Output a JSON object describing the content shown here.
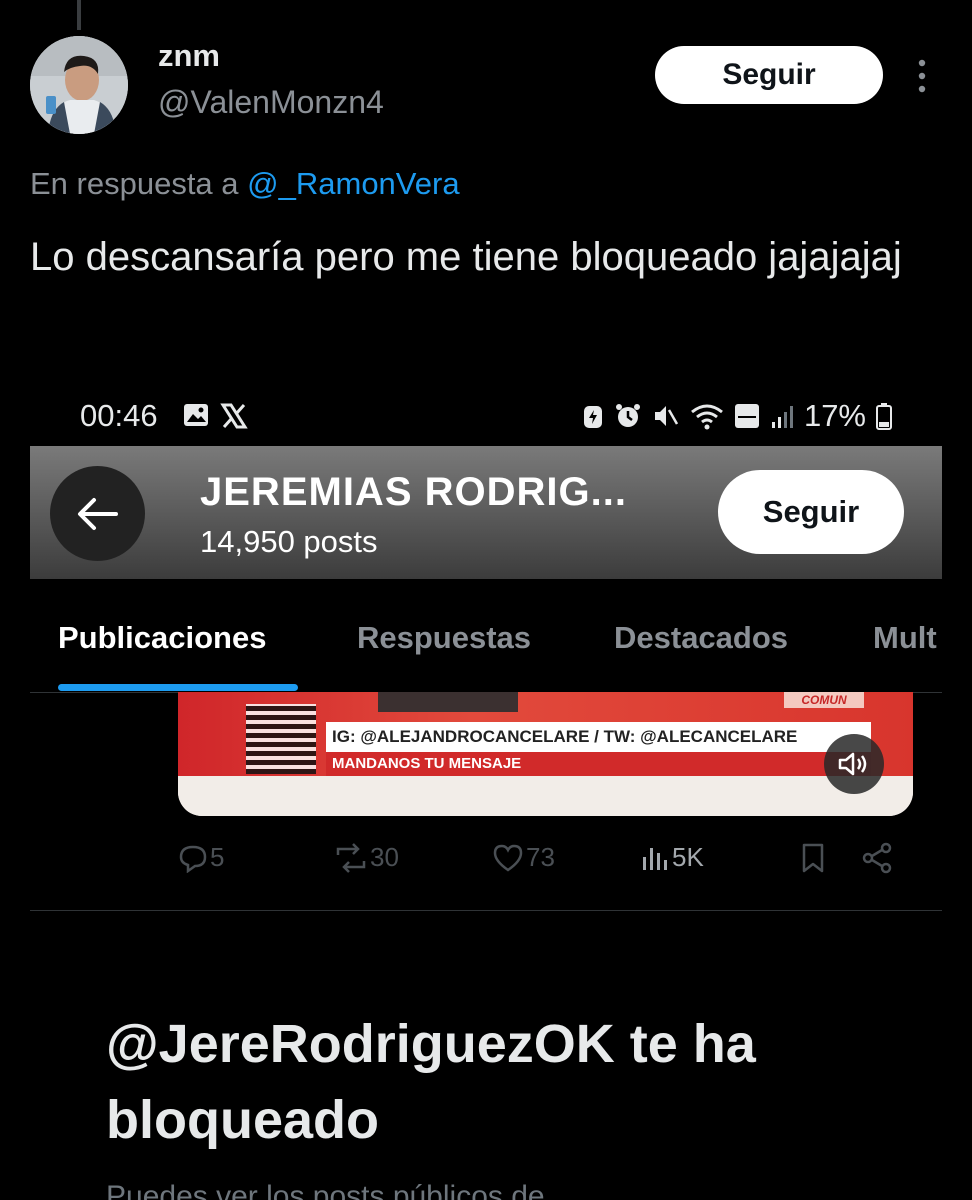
{
  "tweet": {
    "author_name": "znm",
    "author_handle": "@ValenMonzn4",
    "follow_label": "Seguir",
    "reply_prefix": "En respuesta a",
    "reply_mention": "@_RamonVera",
    "text": "Lo descansaría pero me tiene bloqueado jajajajaj"
  },
  "embed": {
    "status_bar": {
      "time": "00:46",
      "battery": "17%"
    },
    "profile": {
      "name": "JEREMIAS RODRIG...",
      "posts": "14,950 posts",
      "follow_label": "Seguir"
    },
    "tabs": [
      "Publicaciones",
      "Respuestas",
      "Destacados",
      "Mult"
    ],
    "video": {
      "tag": "COMUN",
      "ticker": "IG: @ALEJANDROCANCELARE / TW: @ALECANCELARE",
      "ticker_sub": "MANDANOS TU MENSAJE"
    },
    "actions": {
      "replies": "5",
      "reposts": "30",
      "likes": "73",
      "views": "5K"
    },
    "blocked_title": "@JereRodriguezOK te ha bloqueado",
    "cut_text": "Puedes ver los posts públicos de"
  },
  "colors": {
    "accent": "#1d9bf0",
    "background": "#000000"
  }
}
